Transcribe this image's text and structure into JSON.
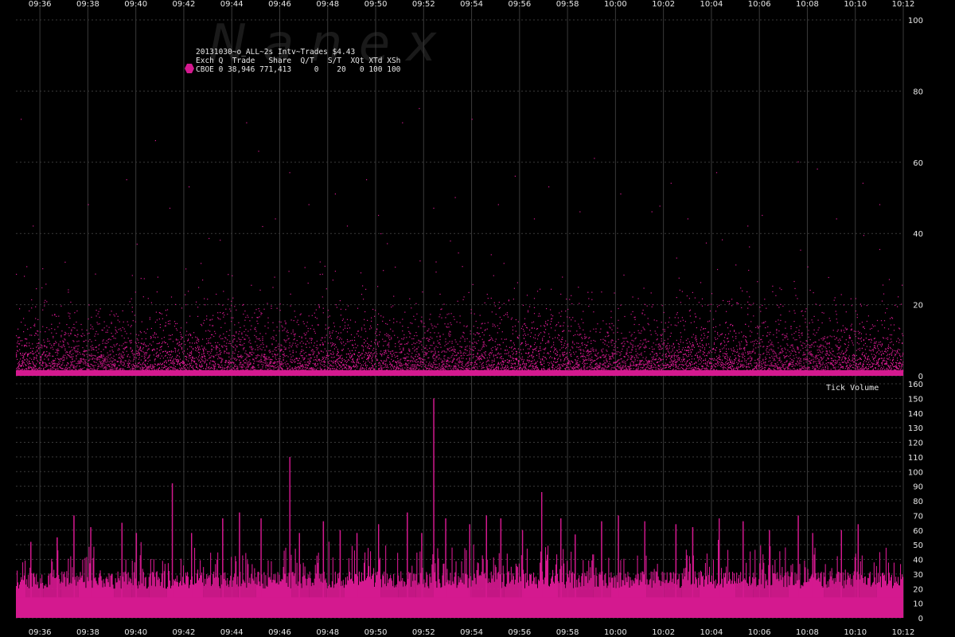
{
  "watermark": "N  a  n  e  x",
  "legend": {
    "title": "20131030~o_ALL~2s Intv~Trades $4.43",
    "header": "Exch Q  Trade   Share  Q/T   S/T  XQt XTd XSh",
    "row": "CBOE 0 38,946 771,413     0    20   0 100 100",
    "marker_color": "#d4198f"
  },
  "colors": {
    "series": "#d4198f",
    "grid": "#3a3a3a",
    "background": "#000000"
  },
  "chart_data": [
    {
      "type": "scatter",
      "title": "",
      "xlabel": "",
      "ylabel": "",
      "x_tick_labels": [
        "09:36",
        "09:38",
        "09:40",
        "09:42",
        "09:44",
        "09:46",
        "09:48",
        "09:50",
        "09:52",
        "09:54",
        "09:56",
        "09:58",
        "10:00",
        "10:02",
        "10:04",
        "10:06",
        "10:08",
        "10:10",
        "10:12"
      ],
      "y_ticks": [
        0,
        20,
        40,
        60,
        80,
        100
      ],
      "ylim": [
        0,
        100
      ],
      "x_range": [
        "09:35",
        "10:12"
      ],
      "series": [
        {
          "name": "CBOE",
          "description_values": "trades per 2s interval, dense 0-20, sparse to ~75",
          "points": [
            [
              0.2,
              72
            ],
            [
              0.7,
              42
            ],
            [
              1.1,
              30
            ],
            [
              3.0,
              48
            ],
            [
              4.6,
              55
            ],
            [
              5.8,
              66
            ],
            [
              6.4,
              47
            ],
            [
              7.2,
              53
            ],
            [
              8.5,
              38
            ],
            [
              9.6,
              71
            ],
            [
              10.1,
              63
            ],
            [
              10.8,
              44
            ],
            [
              11.4,
              57
            ],
            [
              12.2,
              48
            ],
            [
              13.3,
              51
            ],
            [
              13.8,
              42
            ],
            [
              14.6,
              55
            ],
            [
              15.1,
              45
            ],
            [
              16.1,
              71
            ],
            [
              16.8,
              75
            ],
            [
              17.4,
              47
            ],
            [
              18.3,
              50
            ],
            [
              19.0,
              72
            ],
            [
              20.1,
              48
            ],
            [
              20.8,
              56
            ],
            [
              21.6,
              44
            ],
            [
              22.2,
              53
            ],
            [
              23.5,
              46
            ],
            [
              24.1,
              61
            ],
            [
              25.2,
              51
            ],
            [
              26.5,
              46
            ],
            [
              27.3,
              54
            ],
            [
              28.0,
              44
            ],
            [
              29.2,
              57
            ],
            [
              30.5,
              42
            ],
            [
              31.1,
              45
            ],
            [
              32.6,
              60
            ],
            [
              33.4,
              58
            ],
            [
              34.2,
              44
            ],
            [
              35.3,
              54
            ],
            [
              36.0,
              48
            ]
          ]
        }
      ]
    },
    {
      "type": "bar",
      "title": "Tick Volume",
      "xlabel": "",
      "ylabel": "",
      "x_tick_labels": [
        "09:36",
        "09:38",
        "09:40",
        "09:42",
        "09:44",
        "09:46",
        "09:48",
        "09:50",
        "09:52",
        "09:54",
        "09:56",
        "09:58",
        "10:00",
        "10:02",
        "10:04",
        "10:06",
        "10:08",
        "10:10",
        "10:12"
      ],
      "y_ticks": [
        0,
        10,
        20,
        30,
        40,
        50,
        60,
        70,
        80,
        90,
        100,
        110,
        120,
        130,
        140,
        150,
        160
      ],
      "ylim": [
        0,
        160
      ],
      "x_range": [
        "09:35",
        "10:12"
      ],
      "series": [
        {
          "name": "Tick Volume",
          "peaks": [
            [
              0.6,
              52
            ],
            [
              1.7,
              55
            ],
            [
              2.4,
              70
            ],
            [
              3.1,
              62
            ],
            [
              4.4,
              65
            ],
            [
              5.0,
              58
            ],
            [
              6.5,
              92
            ],
            [
              7.3,
              58
            ],
            [
              8.6,
              68
            ],
            [
              9.3,
              72
            ],
            [
              10.2,
              68
            ],
            [
              11.4,
              110
            ],
            [
              11.8,
              58
            ],
            [
              12.8,
              66
            ],
            [
              13.5,
              60
            ],
            [
              14.2,
              58
            ],
            [
              15.1,
              64
            ],
            [
              16.3,
              72
            ],
            [
              16.9,
              58
            ],
            [
              17.4,
              150
            ],
            [
              17.9,
              68
            ],
            [
              18.9,
              64
            ],
            [
              19.6,
              70
            ],
            [
              20.2,
              68
            ],
            [
              21.1,
              60
            ],
            [
              21.9,
              86
            ],
            [
              22.7,
              68
            ],
            [
              23.3,
              57
            ],
            [
              24.4,
              66
            ],
            [
              25.1,
              70
            ],
            [
              26.2,
              66
            ],
            [
              27.5,
              64
            ],
            [
              28.2,
              62
            ],
            [
              29.3,
              68
            ],
            [
              30.3,
              66
            ],
            [
              31.4,
              60
            ],
            [
              32.6,
              70
            ],
            [
              33.2,
              58
            ],
            [
              34.4,
              60
            ],
            [
              35.1,
              64
            ]
          ]
        }
      ]
    }
  ],
  "panel_label": "Tick Volume"
}
